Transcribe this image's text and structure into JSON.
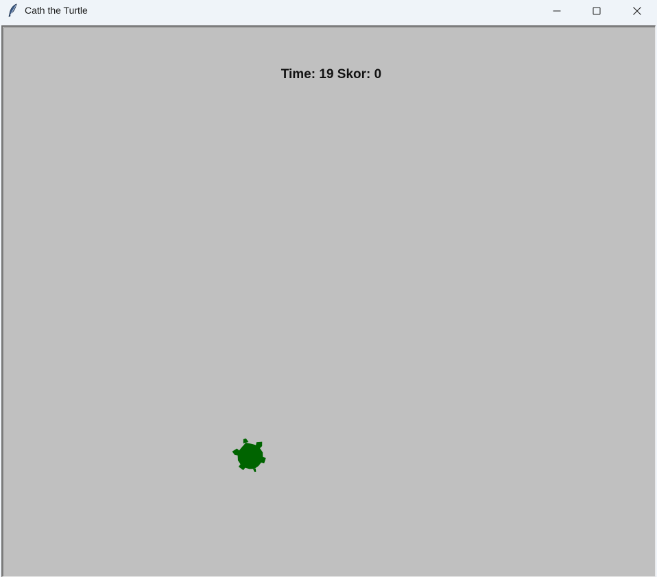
{
  "window": {
    "title": "Cath the Turtle",
    "icon": "feather-icon"
  },
  "controls": {
    "minimize_icon": "minimize-icon",
    "maximize_icon": "maximize-icon",
    "close_icon": "close-icon"
  },
  "hud": {
    "time_label": "Time:",
    "time_value": "19",
    "score_label": "Skor:",
    "score_value": "0"
  },
  "canvas": {
    "background_color": "#c0c0c0"
  },
  "turtle": {
    "color": "#006400"
  }
}
